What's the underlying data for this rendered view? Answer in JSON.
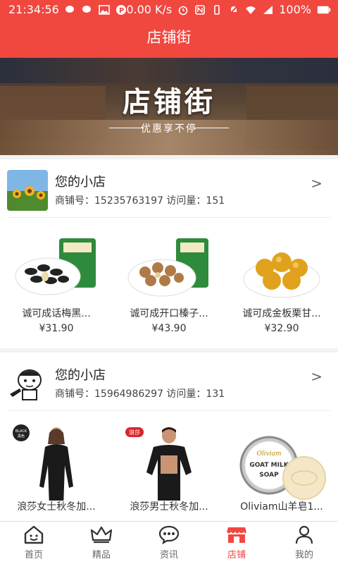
{
  "status": {
    "time": "21:34:56",
    "speed": "0.00 K/s",
    "battery": "100%"
  },
  "header": {
    "title": "店铺街"
  },
  "banner": {
    "title": "店铺街",
    "subtitle": "优惠享不停"
  },
  "shops": [
    {
      "name": "您的小店",
      "meta": "商铺号：15235763197  访问量：151",
      "products": [
        {
          "name": "诚可成话梅黑...",
          "price": "¥31.90",
          "image": "watermelon-seeds"
        },
        {
          "name": "诚可成开口榛子...",
          "price": "¥43.90",
          "image": "hazelnuts"
        },
        {
          "name": "诚可成金板栗甘...",
          "price": "¥32.90",
          "image": "chestnuts"
        }
      ]
    },
    {
      "name": "您的小店",
      "meta": "商铺号：15964986297  访问量：131",
      "products": [
        {
          "name": "浪莎女士秋冬加...",
          "price": "",
          "image": "thermal-women"
        },
        {
          "name": "浪莎男士秋冬加...",
          "price": "",
          "image": "thermal-men"
        },
        {
          "name": "Oliviam山羊皂1...",
          "price": "",
          "image": "goat-soap"
        }
      ]
    }
  ],
  "product_labels": {
    "black_tag": "BLACK",
    "black_tag_cn": "黑色",
    "langsha": "浪莎",
    "soap_brand": "Oliviam",
    "soap_line1": "GOAT MILK",
    "soap_line2": "SOAP"
  },
  "tabs": [
    {
      "label": "首页",
      "icon": "home-icon"
    },
    {
      "label": "精品",
      "icon": "crown-icon"
    },
    {
      "label": "资讯",
      "icon": "chat-icon"
    },
    {
      "label": "店铺",
      "icon": "store-icon",
      "active": true
    },
    {
      "label": "我的",
      "icon": "user-icon"
    }
  ],
  "colors": {
    "accent": "#f0473f"
  }
}
